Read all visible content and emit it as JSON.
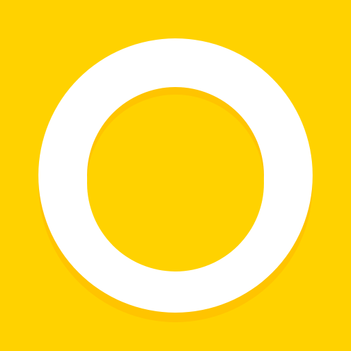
{
  "icon": {
    "name": "ring-logo-icon"
  },
  "colors": {
    "background": "#FFD200",
    "shadow": "#FFC400",
    "ring": "#FFFFFF",
    "center": "#FFD200"
  }
}
